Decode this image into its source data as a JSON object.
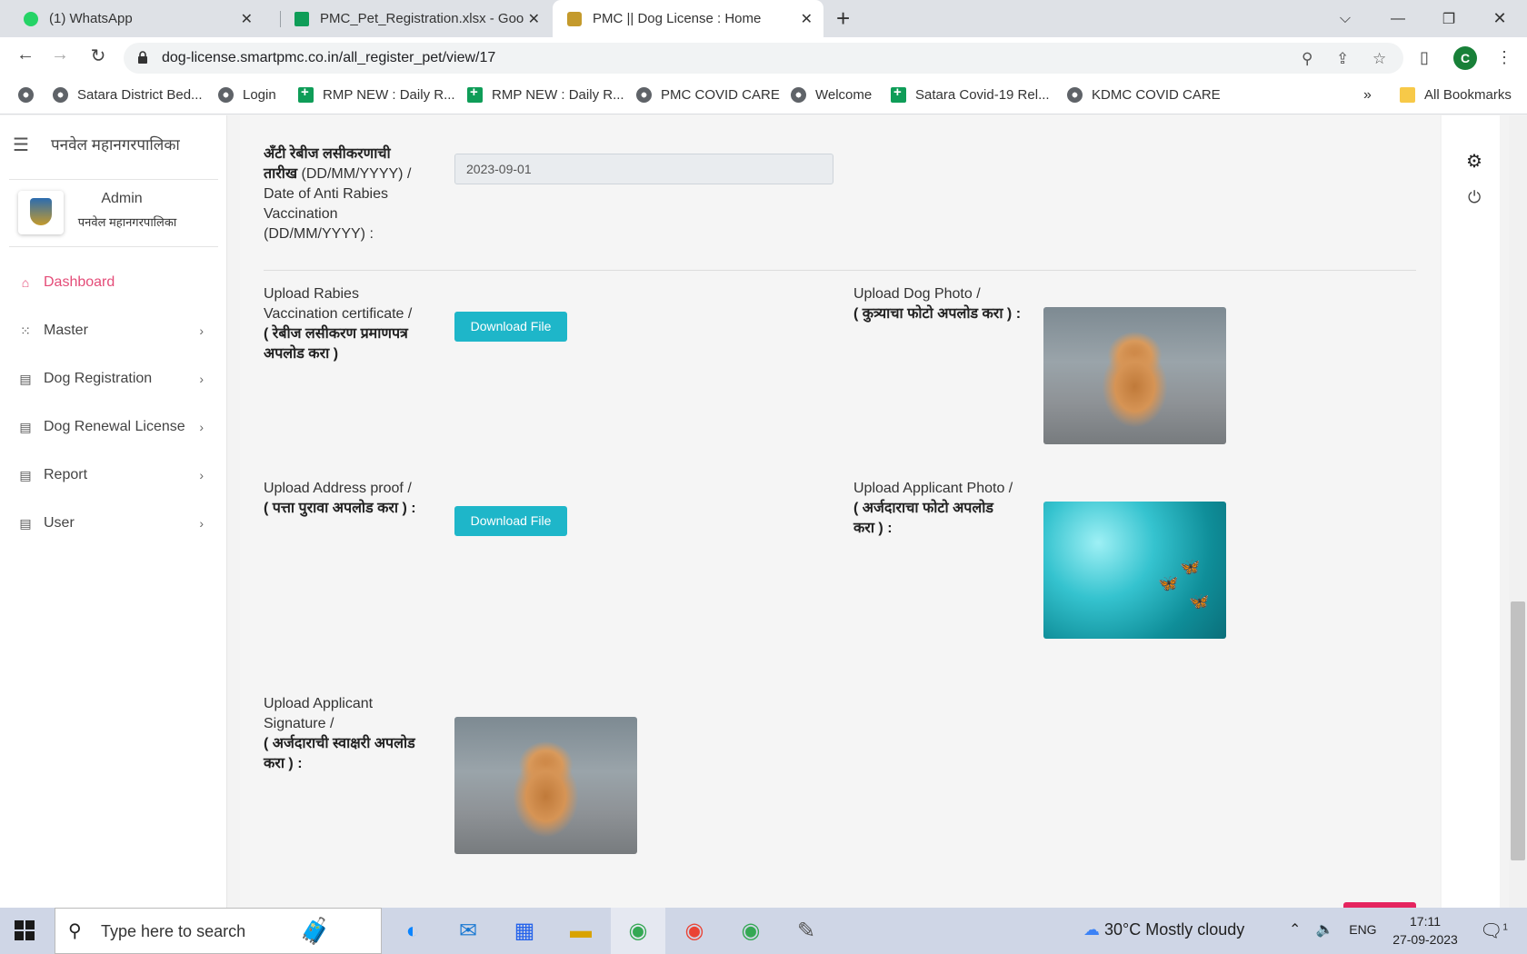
{
  "browser": {
    "tabs": [
      {
        "title": "(1) WhatsApp",
        "favicon": "whatsapp-icon",
        "color": "#25d366"
      },
      {
        "title": "PMC_Pet_Registration.xlsx - Goo",
        "favicon": "sheets-icon",
        "color": "#0f9d58"
      },
      {
        "title": "PMC || Dog License : Home",
        "favicon": "pmc-logo-icon",
        "color": "#c49a2c"
      }
    ],
    "new_tab_label": "+",
    "url": "dog-license.smartpmc.co.in/all_register_pet/view/17",
    "profile_initial": "C",
    "bookmarks": [
      {
        "label": "",
        "icon": "globe-icon"
      },
      {
        "label": "Satara District Bed...",
        "icon": "globe-icon"
      },
      {
        "label": "Login",
        "icon": "globe-icon"
      },
      {
        "label": "RMP NEW : Daily R...",
        "icon": "sheets-icon"
      },
      {
        "label": "RMP NEW : Daily R...",
        "icon": "sheets-icon"
      },
      {
        "label": "PMC COVID CARE",
        "icon": "globe-icon"
      },
      {
        "label": "Welcome",
        "icon": "globe-icon"
      },
      {
        "label": "Satara Covid-19 Rel...",
        "icon": "sheets-icon"
      },
      {
        "label": "KDMC COVID CARE",
        "icon": "globe-icon"
      }
    ],
    "bookmarks_overflow": "»",
    "all_bookmarks": "All Bookmarks"
  },
  "sidebar": {
    "org_name": "पनवेल महानगरपालिका",
    "user_name": "Admin",
    "user_org": "पनवेल महानगरपालिका",
    "menu": [
      {
        "label": "Dashboard",
        "icon": "home-icon",
        "active": true
      },
      {
        "label": "Master",
        "icon": "grid-icon"
      },
      {
        "label": "Dog Registration",
        "icon": "book-icon"
      },
      {
        "label": "Dog Renewal License",
        "icon": "book-icon"
      },
      {
        "label": "Report",
        "icon": "book-icon"
      },
      {
        "label": "User",
        "icon": "book-icon"
      }
    ]
  },
  "form": {
    "rabies_date_label_mr": "अँटी रेबीज लसीकरणाची तारीख",
    "rabies_date_label_rest": "(DD/MM/YYYY) / Date of Anti Rabies Vaccination (DD/MM/YYYY) :",
    "rabies_date_value": "2023-09-01",
    "rabies_cert_label_en": "Upload Rabies Vaccination certificate /",
    "rabies_cert_label_mr": "( रेबीज लसीकरण प्रमाणपत्र अपलोड करा )",
    "address_label_en": "Upload Address proof /",
    "address_label_mr": "( पत्ता पुरावा अपलोड करा ) :",
    "dog_photo_label_en": "Upload Dog Photo /",
    "dog_photo_label_mr": "( कुत्र्याचा फोटो अपलोड करा ) :",
    "applicant_photo_label_en": "Upload Applicant Photo /",
    "applicant_photo_label_mr": "( अर्जदाराचा फोटो अपलोड करा ) :",
    "signature_label_en": "Upload Applicant Signature /",
    "signature_label_mr": "( अर्जदाराची स्वाक्षरी अपलोड करा ) :",
    "download_label": "Download File"
  },
  "taskbar": {
    "search_placeholder": "Type here to search",
    "weather": "30°C  Mostly cloudy",
    "language": "ENG",
    "time": "17:11",
    "date": "27-09-2023",
    "notification_count": "1"
  }
}
